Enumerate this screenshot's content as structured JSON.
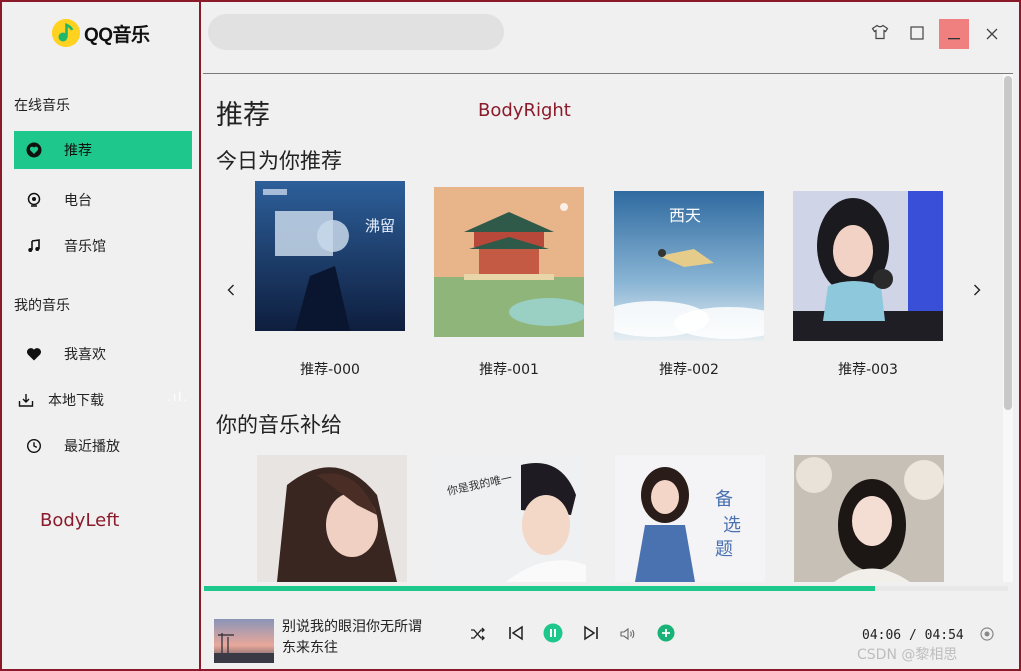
{
  "app": {
    "name": "QQ音乐"
  },
  "sidebar": {
    "section_online": "在线音乐",
    "online_items": [
      {
        "label": "推荐",
        "icon": "heart-circle-icon",
        "active": true
      },
      {
        "label": "电台",
        "icon": "radio-icon"
      },
      {
        "label": "音乐馆",
        "icon": "music-note-icon"
      }
    ],
    "section_mine": "我的音乐",
    "mine_items": [
      {
        "label": "我喜欢",
        "icon": "heart-icon"
      },
      {
        "label": "本地下载",
        "icon": "download-icon"
      },
      {
        "label": "最近播放",
        "icon": "clock-icon"
      }
    ],
    "debug_label": "BodyLeft",
    "stray_text": ".ıl."
  },
  "header": {
    "search_placeholder": "",
    "window_buttons": [
      "skin-icon",
      "maximize-icon",
      "minimize-icon",
      "close-icon"
    ]
  },
  "main": {
    "title": "推荐",
    "debug_label": "BodyRight",
    "section1": {
      "title": "今日为你推荐",
      "items": [
        "推荐-000",
        "推荐-001",
        "推荐-002",
        "推荐-003"
      ],
      "cover_texts": [
        "沸留",
        "",
        "西天",
        ""
      ]
    },
    "section2": {
      "title": "你的音乐补给",
      "cover_texts": [
        "",
        "你是我的唯一",
        "",
        ""
      ]
    }
  },
  "player": {
    "song_line1": "别说我的眼泪你无所谓",
    "song_line2": "东来东往",
    "current_time": "04:06",
    "separator": "/",
    "total_time": "04:54",
    "progress": 0.834,
    "accent": "#1ec78c"
  },
  "watermark": "CSDN @黎相思"
}
